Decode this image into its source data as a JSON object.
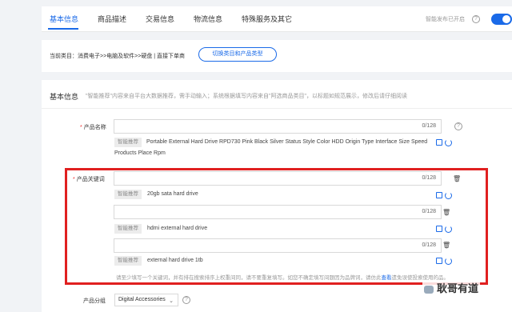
{
  "tabs": [
    "基本信息",
    "商品描述",
    "交易信息",
    "物流信息",
    "特殊服务及其它"
  ],
  "smart_publish": "智能发布已开启",
  "category": {
    "text": "当前类目：消费电子>>电脑及软件>>硬盘 | 直接下单商",
    "switch_label": "切换类目和产品类型"
  },
  "basic": {
    "title": "基本信息",
    "note": "\"智能推荐\"内容来自平台大数据推荐，需手动输入；系统根据填写内容来自\"阿选商品类目\"，以标题如规范展示，修改后请仔细阅读"
  },
  "product_name": {
    "label": "产品名称",
    "counter": "0/128",
    "rec_tag": "智能推荐",
    "recommendation": "Portable External Hard Drive RPD730 Pink Black Silver Status Style Color HDD Origin Type Interface Size Speed",
    "recommendation_line2": "Products Place Rpm"
  },
  "keywords": {
    "label": "产品关键词",
    "rows": [
      {
        "counter": "0/128",
        "rec_tag": "智能推荐",
        "recommendation": "20gb sata hard drive"
      },
      {
        "counter": "0/128",
        "rec_tag": "智能推荐",
        "recommendation": "hdmi external hard drive"
      },
      {
        "counter": "0/128",
        "rec_tag": "智能推荐",
        "recommendation": "external hard drive 1tb"
      }
    ],
    "tip": "请至少填写一个关键词，并有排在搜索排序上权重间同，请不要重复填写。如您不确定填写间题因为品牌词，请仿此",
    "tip_link": "查看",
    "tip_tail": "遗免误使投索使用的品。"
  },
  "group": {
    "label": "产品分组",
    "value": "Digital Accessories"
  },
  "watermark": "耿哥有道"
}
